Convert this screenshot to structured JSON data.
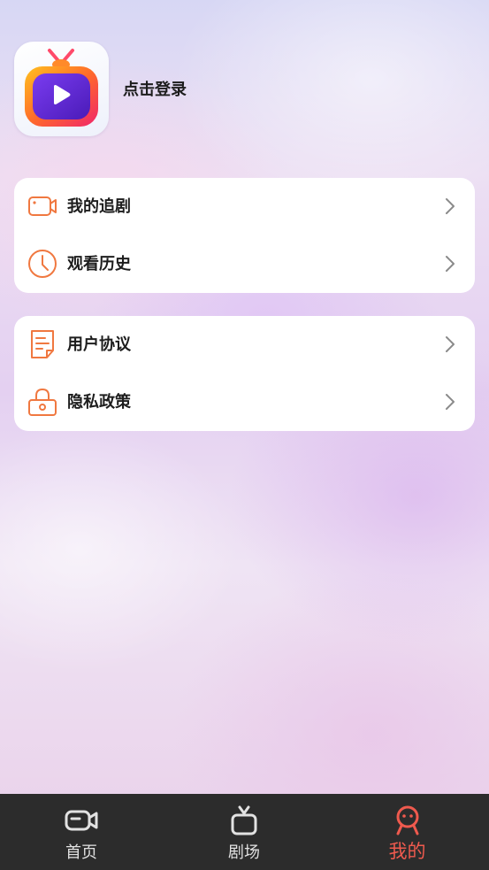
{
  "profile": {
    "login_text": "点击登录",
    "app_icon": "tv-play-app-icon"
  },
  "menu_groups": [
    {
      "items": [
        {
          "label": "我的追剧",
          "icon": "video-camera-icon"
        },
        {
          "label": "观看历史",
          "icon": "clock-icon"
        }
      ]
    },
    {
      "items": [
        {
          "label": "用户协议",
          "icon": "document-icon"
        },
        {
          "label": "隐私政策",
          "icon": "lock-icon"
        }
      ]
    }
  ],
  "tabbar": {
    "tabs": [
      {
        "label": "首页",
        "icon": "video-camera-icon",
        "active": false
      },
      {
        "label": "剧场",
        "icon": "tv-icon",
        "active": false
      },
      {
        "label": "我的",
        "icon": "user-face-icon",
        "active": true
      }
    ]
  },
  "colors": {
    "accent": "#F07840",
    "active_tab": "#EF5A4E",
    "tabbar_bg": "#2C2C2C",
    "chevron": "#8A8A8A"
  }
}
